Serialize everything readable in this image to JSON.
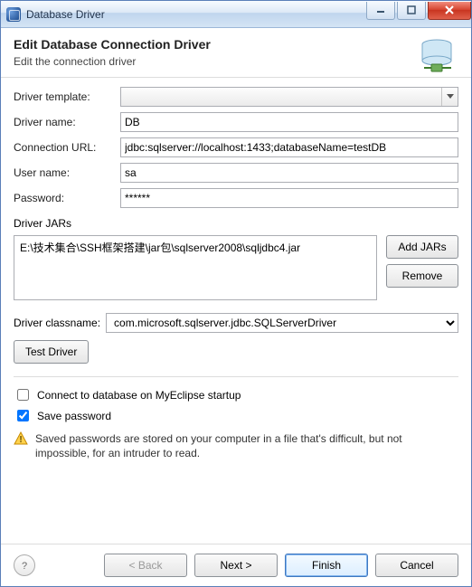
{
  "window": {
    "title": "Database Driver"
  },
  "header": {
    "title": "Edit Database Connection Driver",
    "subtitle": "Edit the connection driver"
  },
  "form": {
    "driver_template_label": "Driver template:",
    "driver_template_value": "",
    "driver_name_label": "Driver name:",
    "driver_name_value": "DB",
    "connection_url_label": "Connection URL:",
    "connection_url_value": "jdbc:sqlserver://localhost:1433;databaseName=testDB",
    "user_name_label": "User name:",
    "user_name_value": "sa",
    "password_label": "Password:",
    "password_value": "******"
  },
  "jars": {
    "section_label": "Driver JARs",
    "items": [
      "E:\\技术集合\\SSH框架搭建\\jar包\\sqlserver2008\\sqljdbc4.jar"
    ],
    "add_label": "Add JARs",
    "remove_label": "Remove"
  },
  "classname": {
    "label": "Driver classname:",
    "value": "com.microsoft.sqlserver.jdbc.SQLServerDriver"
  },
  "test_driver_label": "Test Driver",
  "checks": {
    "connect_startup": {
      "label": "Connect to database on MyEclipse startup",
      "checked": false
    },
    "save_password": {
      "label": "Save password",
      "checked": true
    }
  },
  "warning_text": "Saved passwords are stored on your computer in a file that's difficult, but not impossible, for an intruder to read.",
  "footer": {
    "back": "< Back",
    "next": "Next >",
    "finish": "Finish",
    "cancel": "Cancel"
  }
}
